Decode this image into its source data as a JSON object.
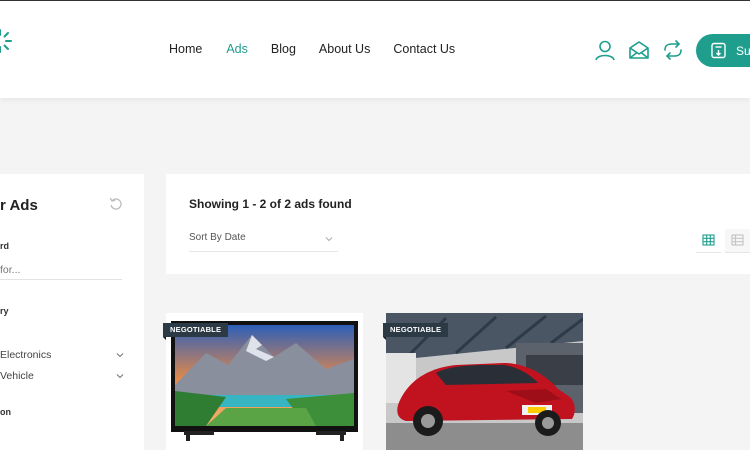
{
  "nav": {
    "items": [
      {
        "label": "Home"
      },
      {
        "label": "Ads"
      },
      {
        "label": "Blog"
      },
      {
        "label": "About Us"
      },
      {
        "label": "Contact Us"
      }
    ],
    "active": "Ads"
  },
  "header": {
    "icons": [
      "user-icon",
      "mail-icon",
      "compare-icon"
    ],
    "submit_label": "Su"
  },
  "sidebar": {
    "title": "r Ads",
    "keyword_label": "rd",
    "keyword_placeholder": "for...",
    "category_label": "ry",
    "categories": [
      {
        "label": "Electronics"
      },
      {
        "label": "Vehicle"
      }
    ],
    "location_label": "on"
  },
  "results": {
    "count_text": "Showing 1 - 2 of 2 ads found",
    "sort_label": "Sort By Date"
  },
  "ads": [
    {
      "badge": "NEGOTIABLE",
      "image": "tv-image"
    },
    {
      "badge": "NEGOTIABLE",
      "image": "red-car-image"
    }
  ],
  "colors": {
    "accent": "#1f9e8e",
    "badge": "#2b3a44"
  }
}
